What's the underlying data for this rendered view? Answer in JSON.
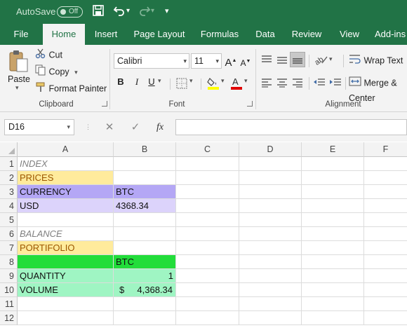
{
  "titlebar": {
    "autosave_label": "AutoSave",
    "autosave_state": "Off",
    "quick_access": [
      "save-icon",
      "undo-icon",
      "redo-icon",
      "customize-icon"
    ]
  },
  "ribbon_tabs": [
    "File",
    "Home",
    "Insert",
    "Page Layout",
    "Formulas",
    "Data",
    "Review",
    "View",
    "Add-ins"
  ],
  "active_tab": "Home",
  "clipboard": {
    "group_label": "Clipboard",
    "paste": "Paste",
    "cut": "Cut",
    "copy": "Copy",
    "format_painter": "Format Painter"
  },
  "font": {
    "group_label": "Font",
    "font_name": "Calibri",
    "font_size": "11",
    "bold": "B",
    "italic": "I",
    "underline": "U"
  },
  "alignment": {
    "group_label": "Alignment",
    "wrap_text": "Wrap Text",
    "merge_center": "Merge & Center"
  },
  "formula_bar": {
    "name_box": "D16",
    "fx": "fx",
    "formula": ""
  },
  "columns": [
    "A",
    "B",
    "C",
    "D",
    "E",
    "F"
  ],
  "rows": [
    "1",
    "2",
    "3",
    "4",
    "5",
    "6",
    "7",
    "8",
    "9",
    "10",
    "11",
    "12"
  ],
  "cells": {
    "A1": "INDEX",
    "A2": "PRICES",
    "A3": "CURRENCY",
    "B3": "BTC",
    "A4": "USD",
    "B4": "4368.34",
    "A6": "BALANCE",
    "A7": "PORTIFOLIO",
    "B8": "BTC",
    "A9": "QUANTITY",
    "B9": "1",
    "A10": "VOLUME",
    "B10_currency": "$",
    "B10_value": "4,368.34"
  },
  "colors": {
    "excel_green": "#217346",
    "yellow_fill": "#ffeb9c",
    "purple_fill": "#b4a7f5",
    "lavender_fill": "#dcd3fb",
    "green_fill": "#22dd3a",
    "mint_fill": "#9ff5c3"
  }
}
